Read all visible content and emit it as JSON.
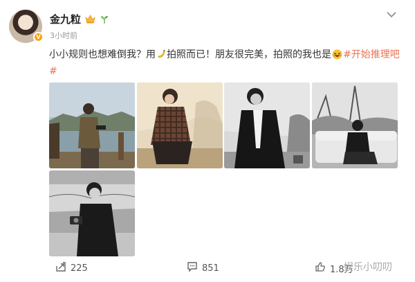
{
  "post": {
    "author": "金九粒",
    "timestamp": "3小时前",
    "text_part1": "小小规则也想难倒我？用",
    "text_part2": "拍照而已！朋友很完美，拍照的我也是",
    "hashtag": "#开始推理吧#",
    "icons": [
      "crown-icon",
      "sprout-icon",
      "banana-icon",
      "laugh-emoji-icon",
      "chevron-down-icon"
    ]
  },
  "photos": [
    {
      "alt": "photo-1"
    },
    {
      "alt": "photo-2"
    },
    {
      "alt": "photo-3"
    },
    {
      "alt": "photo-4"
    },
    {
      "alt": "photo-5"
    }
  ],
  "actions": {
    "repost_count": "225",
    "comment_count": "851",
    "like_count": "1.8万"
  },
  "watermark": "娱乐小叨叨",
  "colors": {
    "hashtag": "#eb7350",
    "verified_badge": "#f8a21a",
    "muted_text": "#999999"
  }
}
